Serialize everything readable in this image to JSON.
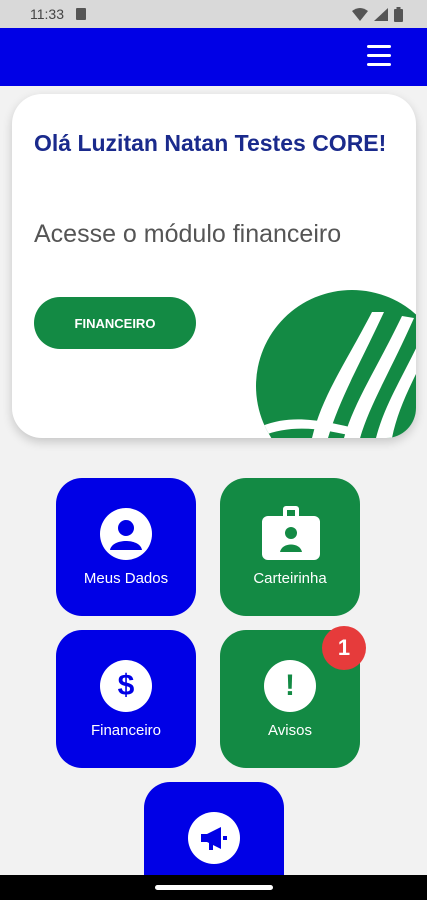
{
  "status_bar": {
    "time": "11:33"
  },
  "header": {
    "menu_icon": "hamburger-menu-icon"
  },
  "hero": {
    "greeting": "Olá Luzitan Natan Testes CORE!",
    "subtitle": "Acesse o módulo financeiro",
    "button_label": "FINANCEIRO"
  },
  "tiles": [
    {
      "label": "Meus Dados",
      "icon": "user-icon",
      "color": "#0000e6"
    },
    {
      "label": "Carteirinha",
      "icon": "id-card-icon",
      "color": "#138a44"
    },
    {
      "label": "Financeiro",
      "icon": "dollar-icon",
      "color": "#0000e6"
    },
    {
      "label": "Avisos",
      "icon": "exclamation-icon",
      "color": "#138a44",
      "badge": "1"
    },
    {
      "label": "",
      "icon": "megaphone-icon",
      "color": "#0000e6"
    }
  ],
  "colors": {
    "primary_blue": "#0000e6",
    "primary_green": "#138a44",
    "badge_red": "#e63b3b",
    "title_navy": "#1a2a8c"
  }
}
